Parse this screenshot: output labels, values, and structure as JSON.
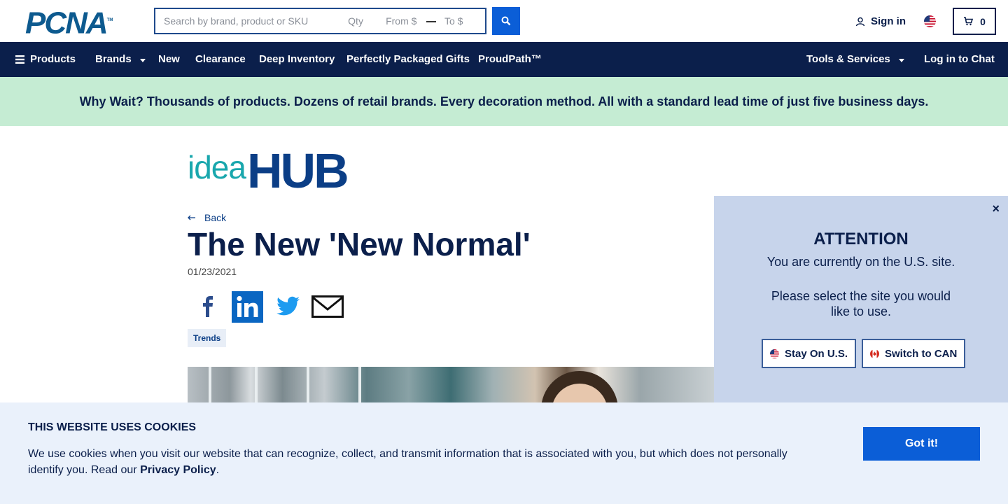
{
  "header": {
    "logo_text": "PCNA",
    "logo_tm": "TM",
    "search_placeholder": "Search by brand, product or SKU",
    "qty_placeholder": "Qty",
    "from_placeholder": "From $",
    "to_placeholder": "To $",
    "signin_label": "Sign in",
    "cart_count": "0"
  },
  "nav": {
    "products": "Products",
    "brands": "Brands",
    "new": "New",
    "clearance": "Clearance",
    "deep_inventory": "Deep Inventory",
    "gifts": "Perfectly Packaged Gifts",
    "proudpath": "ProudPath™",
    "tools": "Tools & Services",
    "chat": "Log in to Chat"
  },
  "promo": {
    "text": "Why Wait? Thousands of products. Dozens of retail brands. Every decoration method. All with a standard lead time of just five business days."
  },
  "article": {
    "logo_idea": "idea",
    "logo_hub": "HUB",
    "back_label": "Back",
    "title": "The New 'New Normal'",
    "date": "01/23/2021",
    "tag": "Trends"
  },
  "attention": {
    "close": "×",
    "title": "ATTENTION",
    "line1": "You are currently on the U.S. site.",
    "line2": "Please select the site you would like to use.",
    "stay_label": "Stay On U.S.",
    "switch_label": "Switch to CAN"
  },
  "cookie": {
    "title": "THIS WEBSITE USES COOKIES",
    "text": "We use cookies when you visit our website that can recognize, collect, and transmit information that is associated with you, but which does not personally identify you. Read our ",
    "link": "Privacy Policy",
    "period": ".",
    "button": "Got it!"
  },
  "colors": {
    "navy": "#0b1f4b",
    "accent_blue": "#0b5ed7",
    "promo_bg": "#c5ecd3",
    "modal_bg": "#c7d4eb",
    "cookie_bg": "#eaf1fb"
  }
}
